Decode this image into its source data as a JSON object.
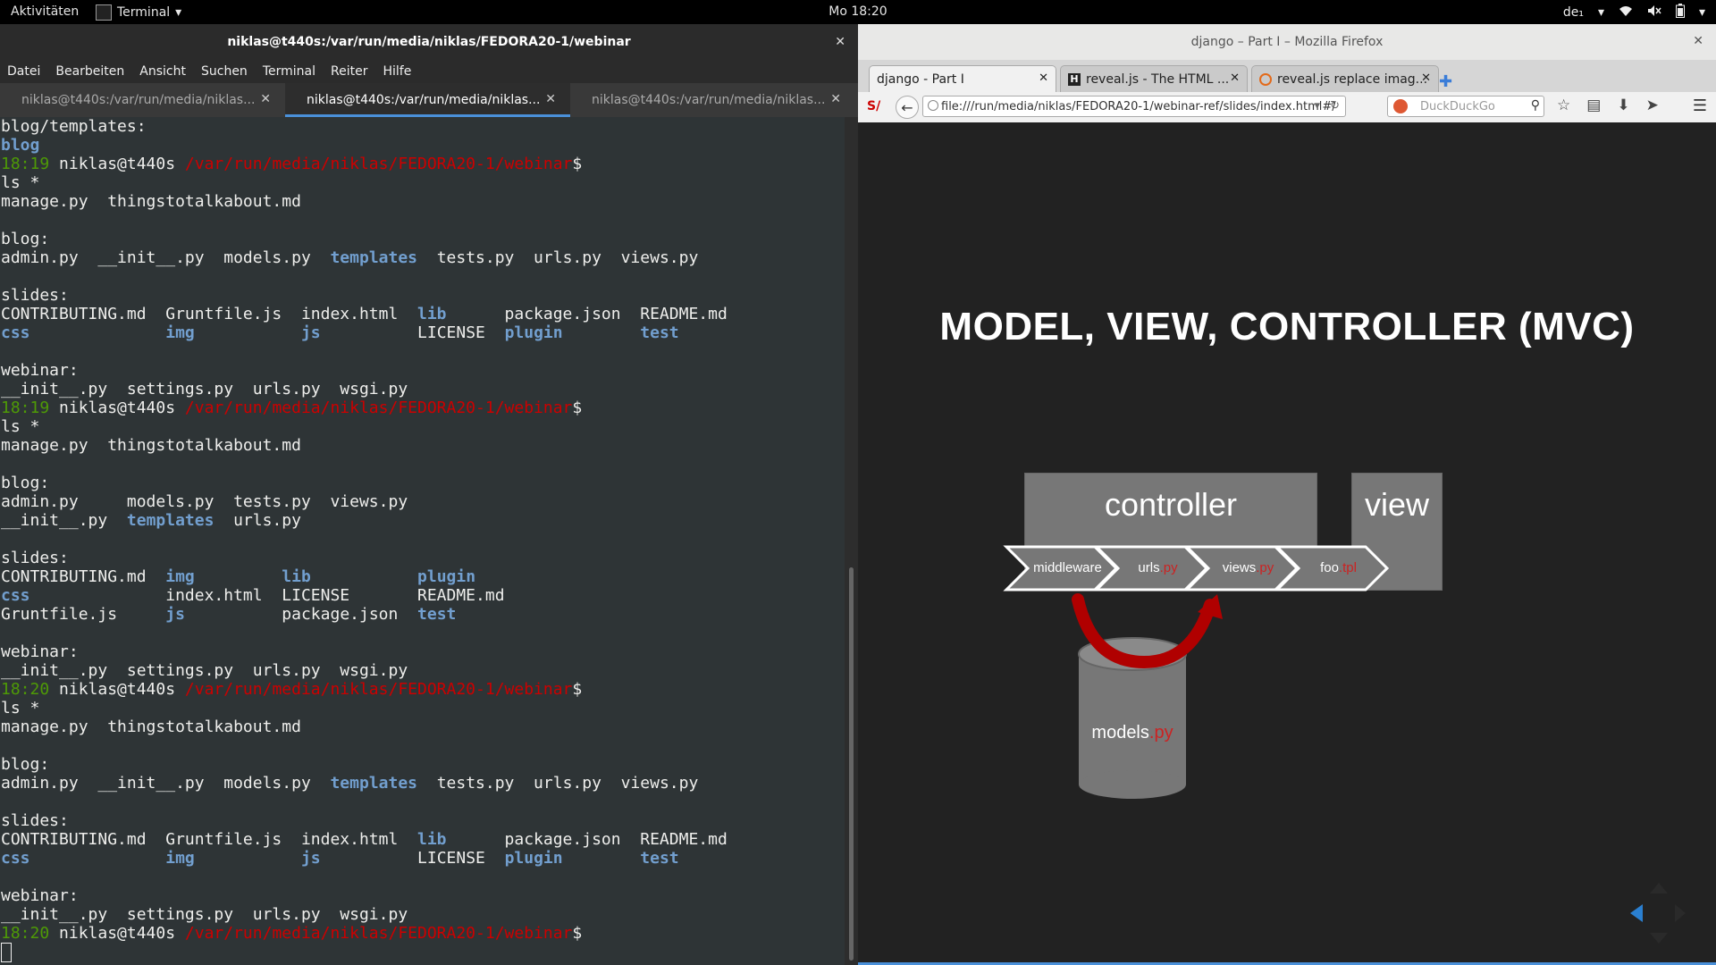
{
  "topbar": {
    "activities": "Aktivitäten",
    "app_menu": "Terminal",
    "clock": "Mo 18:20",
    "keyboard": "de₁",
    "icons": [
      "wifi-icon",
      "volume-muted-icon",
      "battery-icon"
    ]
  },
  "terminal": {
    "title": "niklas@t440s:/var/run/media/niklas/FEDORA20-1/webinar",
    "menu": [
      "Datei",
      "Bearbeiten",
      "Ansicht",
      "Suchen",
      "Terminal",
      "Reiter",
      "Hilfe"
    ],
    "tabs": [
      {
        "label": "niklas@t440s:/var/run/media/niklas...",
        "active": false
      },
      {
        "label": "niklas@t440s:/var/run/media/niklas...",
        "active": true
      },
      {
        "label": "niklas@t440s:/var/run/media/niklas...",
        "active": false
      }
    ],
    "lines": [
      [
        {
          "t": "blog/templates:"
        }
      ],
      [
        {
          "t": "blog",
          "c": "blue"
        }
      ],
      [
        {
          "t": "18:19",
          "c": "green"
        },
        {
          "t": " niklas@t440s "
        },
        {
          "t": "/var/run/media/niklas/FEDORA20-1/webinar",
          "c": "red"
        },
        {
          "t": "$"
        }
      ],
      [
        {
          "t": "ls *"
        }
      ],
      [
        {
          "t": "manage.py  thingstotalkabout.md"
        }
      ],
      [
        {
          "t": ""
        }
      ],
      [
        {
          "t": "blog:"
        }
      ],
      [
        {
          "t": "admin.py  __init__.py  models.py  "
        },
        {
          "t": "templates",
          "c": "blue"
        },
        {
          "t": "  tests.py  urls.py  views.py"
        }
      ],
      [
        {
          "t": ""
        }
      ],
      [
        {
          "t": "slides:"
        }
      ],
      [
        {
          "t": "CONTRIBUTING.md  Gruntfile.js  index.html  "
        },
        {
          "t": "lib",
          "c": "blue"
        },
        {
          "t": "      package.json  README.md"
        }
      ],
      [
        {
          "t": "css",
          "c": "blue"
        },
        {
          "t": "              "
        },
        {
          "t": "img",
          "c": "blue"
        },
        {
          "t": "           "
        },
        {
          "t": "js",
          "c": "blue"
        },
        {
          "t": "          LICENSE  "
        },
        {
          "t": "plugin",
          "c": "blue"
        },
        {
          "t": "        "
        },
        {
          "t": "test",
          "c": "blue"
        }
      ],
      [
        {
          "t": ""
        }
      ],
      [
        {
          "t": "webinar:"
        }
      ],
      [
        {
          "t": "__init__.py  settings.py  urls.py  wsgi.py"
        }
      ],
      [
        {
          "t": "18:19",
          "c": "green"
        },
        {
          "t": " niklas@t440s "
        },
        {
          "t": "/var/run/media/niklas/FEDORA20-1/webinar",
          "c": "red"
        },
        {
          "t": "$"
        }
      ],
      [
        {
          "t": "ls *"
        }
      ],
      [
        {
          "t": "manage.py  thingstotalkabout.md"
        }
      ],
      [
        {
          "t": ""
        }
      ],
      [
        {
          "t": "blog:"
        }
      ],
      [
        {
          "t": "admin.py     models.py  tests.py  views.py"
        }
      ],
      [
        {
          "t": "__init__.py  "
        },
        {
          "t": "templates",
          "c": "blue"
        },
        {
          "t": "  urls.py"
        }
      ],
      [
        {
          "t": ""
        }
      ],
      [
        {
          "t": "slides:"
        }
      ],
      [
        {
          "t": "CONTRIBUTING.md  "
        },
        {
          "t": "img",
          "c": "blue"
        },
        {
          "t": "         "
        },
        {
          "t": "lib",
          "c": "blue"
        },
        {
          "t": "           "
        },
        {
          "t": "plugin",
          "c": "blue"
        }
      ],
      [
        {
          "t": "css",
          "c": "blue"
        },
        {
          "t": "              index.html  LICENSE       README.md"
        }
      ],
      [
        {
          "t": "Gruntfile.js     "
        },
        {
          "t": "js",
          "c": "blue"
        },
        {
          "t": "          package.json  "
        },
        {
          "t": "test",
          "c": "blue"
        }
      ],
      [
        {
          "t": ""
        }
      ],
      [
        {
          "t": "webinar:"
        }
      ],
      [
        {
          "t": "__init__.py  settings.py  urls.py  wsgi.py"
        }
      ],
      [
        {
          "t": "18:20",
          "c": "green"
        },
        {
          "t": " niklas@t440s "
        },
        {
          "t": "/var/run/media/niklas/FEDORA20-1/webinar",
          "c": "red"
        },
        {
          "t": "$"
        }
      ],
      [
        {
          "t": "ls *"
        }
      ],
      [
        {
          "t": "manage.py  thingstotalkabout.md"
        }
      ],
      [
        {
          "t": ""
        }
      ],
      [
        {
          "t": "blog:"
        }
      ],
      [
        {
          "t": "admin.py  __init__.py  models.py  "
        },
        {
          "t": "templates",
          "c": "blue"
        },
        {
          "t": "  tests.py  urls.py  views.py"
        }
      ],
      [
        {
          "t": ""
        }
      ],
      [
        {
          "t": "slides:"
        }
      ],
      [
        {
          "t": "CONTRIBUTING.md  Gruntfile.js  index.html  "
        },
        {
          "t": "lib",
          "c": "blue"
        },
        {
          "t": "      package.json  README.md"
        }
      ],
      [
        {
          "t": "css",
          "c": "blue"
        },
        {
          "t": "              "
        },
        {
          "t": "img",
          "c": "blue"
        },
        {
          "t": "           "
        },
        {
          "t": "js",
          "c": "blue"
        },
        {
          "t": "          LICENSE  "
        },
        {
          "t": "plugin",
          "c": "blue"
        },
        {
          "t": "        "
        },
        {
          "t": "test",
          "c": "blue"
        }
      ],
      [
        {
          "t": ""
        }
      ],
      [
        {
          "t": "webinar:"
        }
      ],
      [
        {
          "t": "__init__.py  settings.py  urls.py  wsgi.py"
        }
      ],
      [
        {
          "t": "18:20",
          "c": "green"
        },
        {
          "t": " niklas@t440s "
        },
        {
          "t": "/var/run/media/niklas/FEDORA20-1/webinar",
          "c": "red"
        },
        {
          "t": "$"
        }
      ]
    ]
  },
  "firefox": {
    "title": "django – Part I – Mozilla Firefox",
    "tabs": [
      {
        "label": "django - Part I",
        "active": true,
        "favicon": ""
      },
      {
        "label": "reveal.js - The HTML ...",
        "active": false,
        "favicon": "H"
      },
      {
        "label": "reveal.js replace imag...",
        "active": false,
        "favicon": ""
      }
    ],
    "url": "file:///run/media/niklas/FEDORA20-1/webinar-ref/slides/index.html#/",
    "search_placeholder": "DuckDuckGo",
    "slide": {
      "title": "MODEL, VIEW, CONTROLLER (MVC)",
      "controller_label": "controller",
      "view_label": "view",
      "steps": [
        {
          "name": "middleware",
          "ext": ""
        },
        {
          "name": "urls",
          "ext": ".py"
        },
        {
          "name": "views",
          "ext": ".py"
        },
        {
          "name": "foo",
          "ext": ".tpl"
        }
      ],
      "models": {
        "name": "models",
        "ext": ".py"
      }
    }
  },
  "colors": {
    "dir_blue": "#729fcf",
    "prompt_green": "#4e9a06",
    "path_red": "#cc0000",
    "accent": "#4a90d9"
  }
}
